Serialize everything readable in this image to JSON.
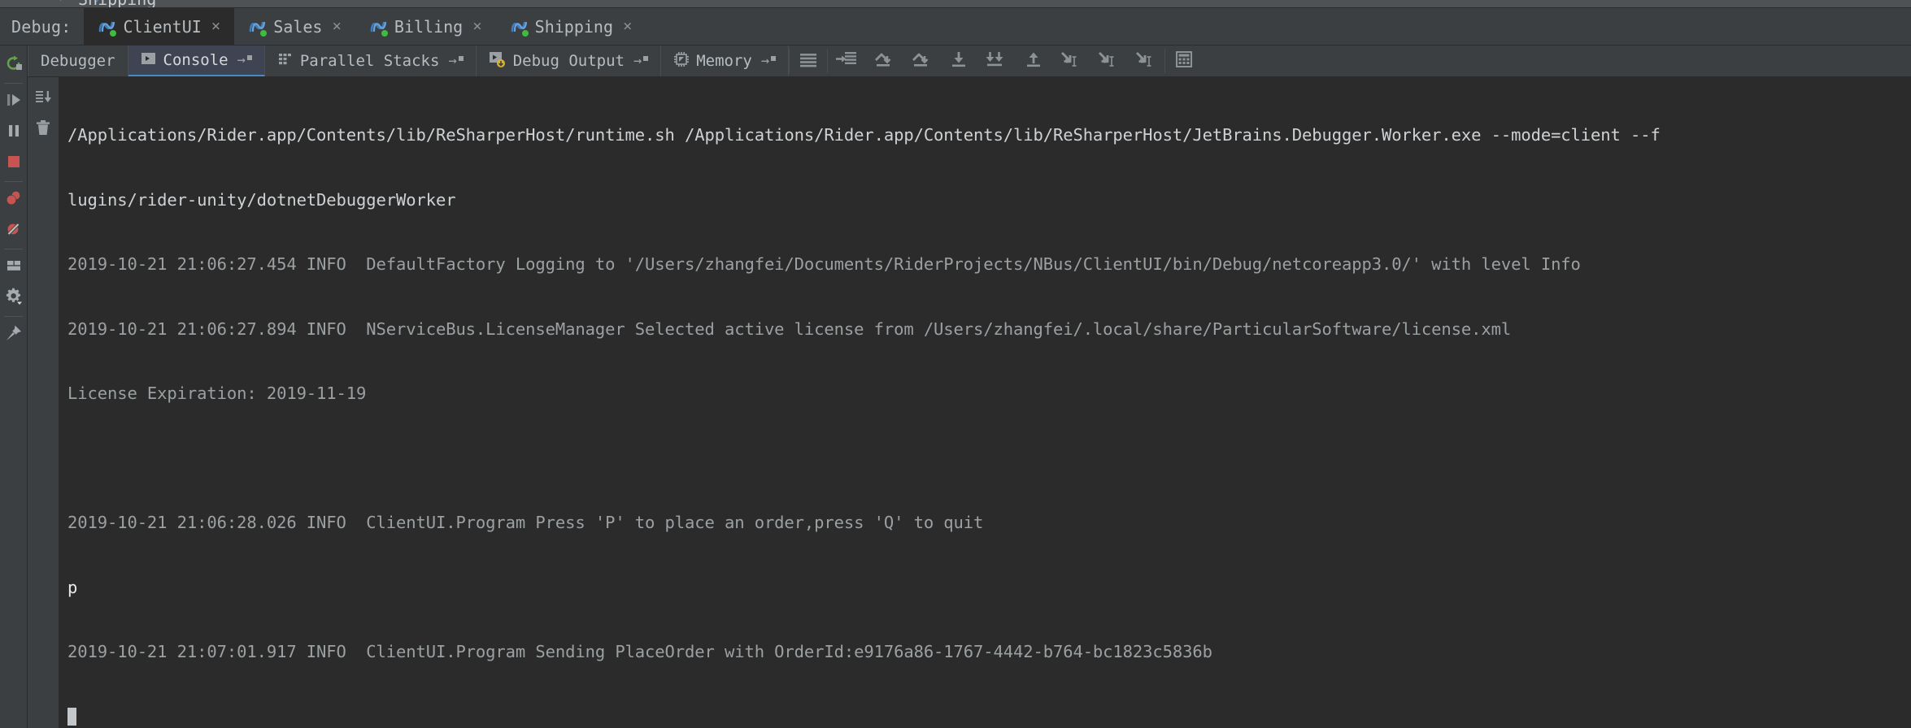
{
  "window": {
    "background": "#3c3f41",
    "console_background": "#2b2b2b",
    "accent": "#4a88c7"
  },
  "ghost_tab": {
    "label": "Shipping",
    "chevron": "⌄"
  },
  "session_bar": {
    "label": "Debug:",
    "tabs": [
      {
        "label": "ClientUI",
        "icon": "nservicebus-icon",
        "status": "running",
        "active": true,
        "close": "×"
      },
      {
        "label": "Sales",
        "icon": "nservicebus-icon",
        "status": "running",
        "active": false,
        "close": "×"
      },
      {
        "label": "Billing",
        "icon": "nservicebus-icon",
        "status": "running",
        "active": false,
        "close": "×"
      },
      {
        "label": "Shipping",
        "icon": "nservicebus-icon",
        "status": "running",
        "active": false,
        "close": "×"
      }
    ]
  },
  "rail": {
    "buttons": [
      {
        "name": "rerun-button",
        "icon": "rerun-icon",
        "color": "#5fa544"
      },
      {
        "name": "resume-program-button",
        "icon": "resume-icon",
        "color": "#9ea3a6"
      },
      {
        "name": "pause-program-button",
        "icon": "pause-icon",
        "color": "#9ea3a6"
      },
      {
        "name": "stop-button",
        "icon": "stop-square-icon",
        "color": "#c75450"
      },
      {
        "name": "view-breakpoints-button",
        "icon": "breakpoints-icon",
        "color": "#c75450"
      },
      {
        "name": "mute-breakpoints-button",
        "icon": "mute-breakpoints-icon",
        "color": "#c75450"
      },
      {
        "name": "restore-layout-button",
        "icon": "layout-icon",
        "color": "#a6abaf"
      },
      {
        "name": "settings-button",
        "icon": "gear-icon",
        "color": "#a6abaf"
      },
      {
        "name": "pin-tab-button",
        "icon": "pin-icon",
        "color": "#a6abaf"
      }
    ]
  },
  "tool_tabs": {
    "tabs": [
      {
        "label": "Debugger",
        "icon": null,
        "selected": false,
        "pinned": false
      },
      {
        "label": "Console",
        "icon": "console-icon",
        "selected": true,
        "pinned": true
      },
      {
        "label": "Parallel Stacks",
        "icon": "parallel-stacks-icon",
        "selected": false,
        "pinned": true
      },
      {
        "label": "Debug Output",
        "icon": "debug-output-icon",
        "selected": false,
        "pinned": true
      },
      {
        "label": "Memory",
        "icon": "memory-chip-icon",
        "selected": false,
        "pinned": true
      }
    ],
    "pin_arrow": "→",
    "icon_buttons": [
      {
        "name": "show-all-frames-button",
        "icon": "lines-icon"
      },
      {
        "name": "force-step-into-button",
        "icon": "force-step-into-icon"
      },
      {
        "name": "step-over-button",
        "icon": "step-over-icon"
      },
      {
        "name": "step-over-2-button",
        "icon": "step-over-icon"
      },
      {
        "name": "step-into-button",
        "icon": "step-into-icon"
      },
      {
        "name": "force-step-into-2-button",
        "icon": "force-step-into-down-icon"
      },
      {
        "name": "step-out-button",
        "icon": "step-out-icon"
      },
      {
        "name": "run-to-cursor-button",
        "icon": "run-to-cursor-icon"
      },
      {
        "name": "run-to-cursor-2-button",
        "icon": "run-to-cursor-icon"
      },
      {
        "name": "run-to-cursor-3-button",
        "icon": "run-to-cursor-icon"
      },
      {
        "name": "evaluate-expression-button",
        "icon": "calculator-icon"
      }
    ]
  },
  "console_gutter": {
    "buttons": [
      {
        "name": "scroll-to-end-button",
        "icon": "scroll-to-end-icon"
      },
      {
        "name": "clear-all-button",
        "icon": "trash-icon"
      }
    ]
  },
  "console": {
    "lines": [
      {
        "type": "cmd",
        "text": "/Applications/Rider.app/Contents/lib/ReSharperHost/runtime.sh /Applications/Rider.app/Contents/lib/ReSharperHost/JetBrains.Debugger.Worker.exe --mode=client --f"
      },
      {
        "type": "cmd",
        "text": "lugins/rider-unity/dotnetDebuggerWorker"
      },
      {
        "type": "log",
        "text": "2019-10-21 21:06:27.454 INFO  DefaultFactory Logging to '/Users/zhangfei/Documents/RiderProjects/NBus/ClientUI/bin/Debug/netcoreapp3.0/' with level Info"
      },
      {
        "type": "log",
        "text": "2019-10-21 21:06:27.894 INFO  NServiceBus.LicenseManager Selected active license from /Users/zhangfei/.local/share/ParticularSoftware/license.xml"
      },
      {
        "type": "log",
        "text": "License Expiration: 2019-11-19"
      },
      {
        "type": "blank",
        "text": ""
      },
      {
        "type": "log",
        "text": "2019-10-21 21:06:28.026 INFO  ClientUI.Program Press 'P' to place an order,press 'Q' to quit"
      },
      {
        "type": "input",
        "text": "p"
      },
      {
        "type": "log",
        "text": "2019-10-21 21:07:01.917 INFO  ClientUI.Program Sending PlaceOrder with OrderId:e9176a86-1767-4442-b764-bc1823c5836b"
      },
      {
        "type": "cursor",
        "text": ""
      }
    ]
  }
}
